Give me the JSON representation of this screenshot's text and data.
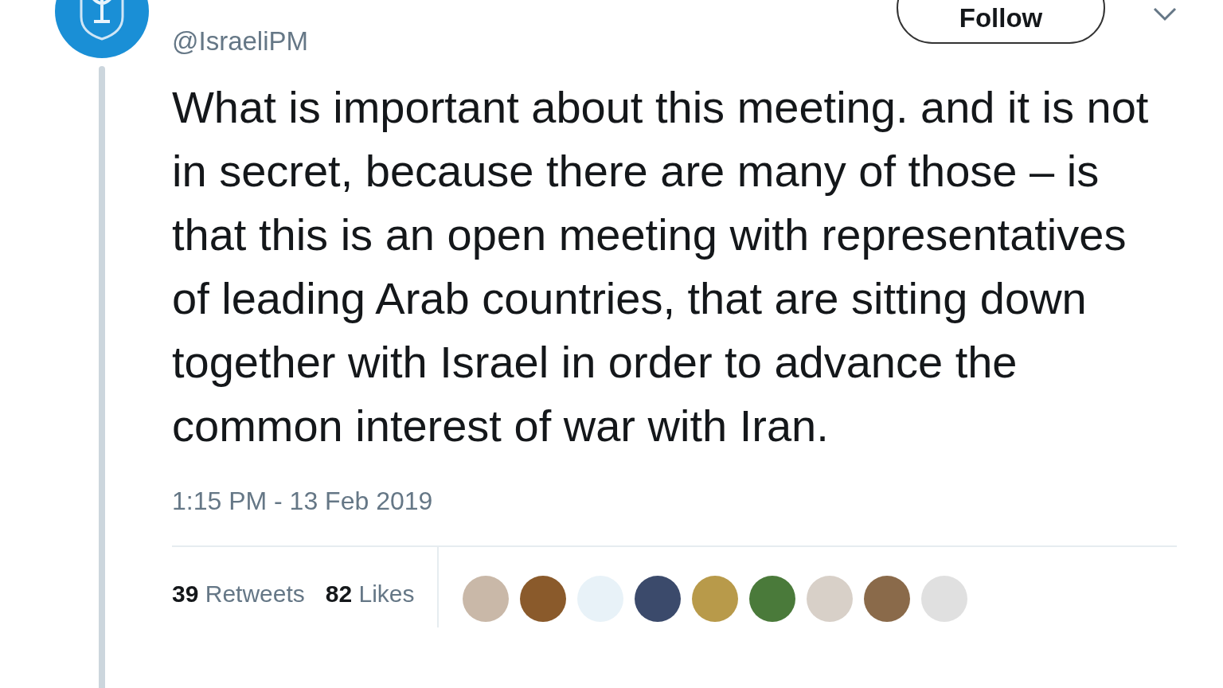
{
  "account": {
    "handle": "@IsraeliPM"
  },
  "follow_button": {
    "label": "Follow"
  },
  "tweet": {
    "text": "What is important about this meeting. and it is not in secret, because there are many of those – is that this is an open meeting with representatives of leading Arab countries, that are sitting down together with Israel in order to advance the common interest of war with Iran.",
    "timestamp": "1:15 PM - 13 Feb 2019"
  },
  "stats": [
    {
      "count": "39",
      "label": "Retweets"
    },
    {
      "count": "82",
      "label": "Likes"
    }
  ],
  "likers": [
    {
      "color": "#c9b8a8"
    },
    {
      "color": "#8a5a2b"
    },
    {
      "color": "#e8f2f8"
    },
    {
      "color": "#3b4a6b"
    },
    {
      "color": "#b89a4a"
    },
    {
      "color": "#4a7a3a"
    },
    {
      "color": "#d8d0c8"
    },
    {
      "color": "#8a6a4a"
    },
    {
      "color": "#e0e0e0"
    }
  ]
}
